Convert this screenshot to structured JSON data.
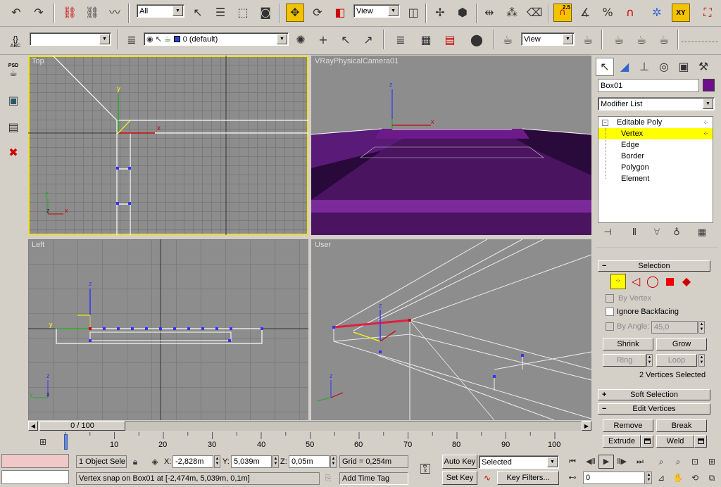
{
  "main_toolbar": {
    "selection_filter": "All",
    "ref_coord": "View",
    "snap_value": "2.5",
    "constraint": "XY"
  },
  "secondary_toolbar": {
    "named_selection": "",
    "layer_name": "0 (default)",
    "view_dropdown": "View",
    "abc_label": "ABC"
  },
  "left_sidebar": {
    "psd_label": "PSD"
  },
  "viewports": {
    "top_label": "Top",
    "camera_label": "VRayPhysicalCamera01",
    "left_label": "Left",
    "user_label": "User"
  },
  "command_panel": {
    "object_name": "Box01",
    "object_color": "#6c0f8a",
    "modifier_list": "Modifier List",
    "stack": [
      {
        "label": "Editable Poly",
        "level": 0
      },
      {
        "label": "Vertex",
        "level": 1,
        "selected": true
      },
      {
        "label": "Edge",
        "level": 1
      },
      {
        "label": "Border",
        "level": 1
      },
      {
        "label": "Polygon",
        "level": 1
      },
      {
        "label": "Element",
        "level": 1
      }
    ],
    "selection_rollout": {
      "title": "Selection",
      "by_vertex": "By Vertex",
      "ignore_backfacing": "Ignore Backfacing",
      "by_angle": "By Angle:",
      "angle_value": "45,0",
      "shrink": "Shrink",
      "grow": "Grow",
      "ring": "Ring",
      "loop": "Loop",
      "status": "2 Vertices Selected"
    },
    "soft_selection_title": "Soft Selection",
    "edit_vertices": {
      "title": "Edit Vertices",
      "remove": "Remove",
      "break": "Break",
      "extrude": "Extrude",
      "weld": "Weld"
    }
  },
  "timeline": {
    "slider_text": "0 / 100",
    "ticks": [
      "10",
      "20",
      "30",
      "40",
      "50",
      "60",
      "70",
      "80",
      "90",
      "100"
    ]
  },
  "status_bar": {
    "selection_info": "1 Object Sele",
    "x_label": "X:",
    "x_value": "-2,828m",
    "y_label": "Y:",
    "y_value": "5,039m",
    "z_label": "Z:",
    "z_value": "0,05m",
    "grid": "Grid = 0,254m",
    "prompt": "Vertex snap on Box01 at [-2,474m, 5,039m, 0,1m]",
    "add_time_tag": "Add Time Tag",
    "auto_key": "Auto Key",
    "set_key": "Set Key",
    "key_mode": "Selected",
    "key_filters": "Key Filters...",
    "frame": "0"
  }
}
